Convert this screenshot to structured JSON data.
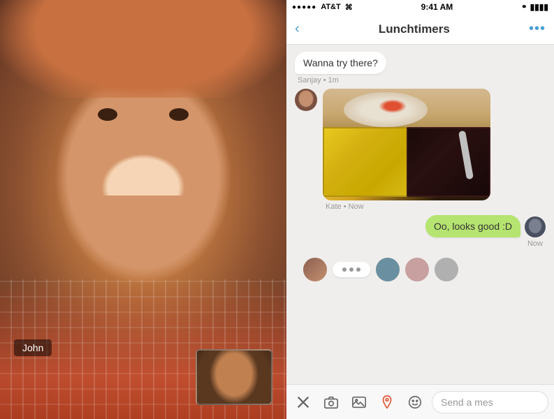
{
  "status_bar": {
    "carrier": "AT&T",
    "time": "9:41 AM",
    "wifi": "wifi",
    "battery": "battery"
  },
  "nav": {
    "title": "Lunchtimers",
    "back_label": "‹",
    "more_label": "•••"
  },
  "messages": [
    {
      "id": "msg1",
      "type": "received_text",
      "text": "Wanna try there?",
      "sender": "Sanjay",
      "time": "1m"
    },
    {
      "id": "msg2",
      "type": "received_image",
      "sender": "Kate",
      "time": "Now"
    },
    {
      "id": "msg3",
      "type": "sent",
      "text": "Oo, looks good :D",
      "time": "Now"
    }
  ],
  "video": {
    "name_label": "John"
  },
  "toolbar": {
    "close_label": "✕",
    "camera_label": "camera",
    "image_label": "image",
    "location_label": "location",
    "emoji_label": "emoji",
    "input_placeholder": "Send a mes"
  }
}
